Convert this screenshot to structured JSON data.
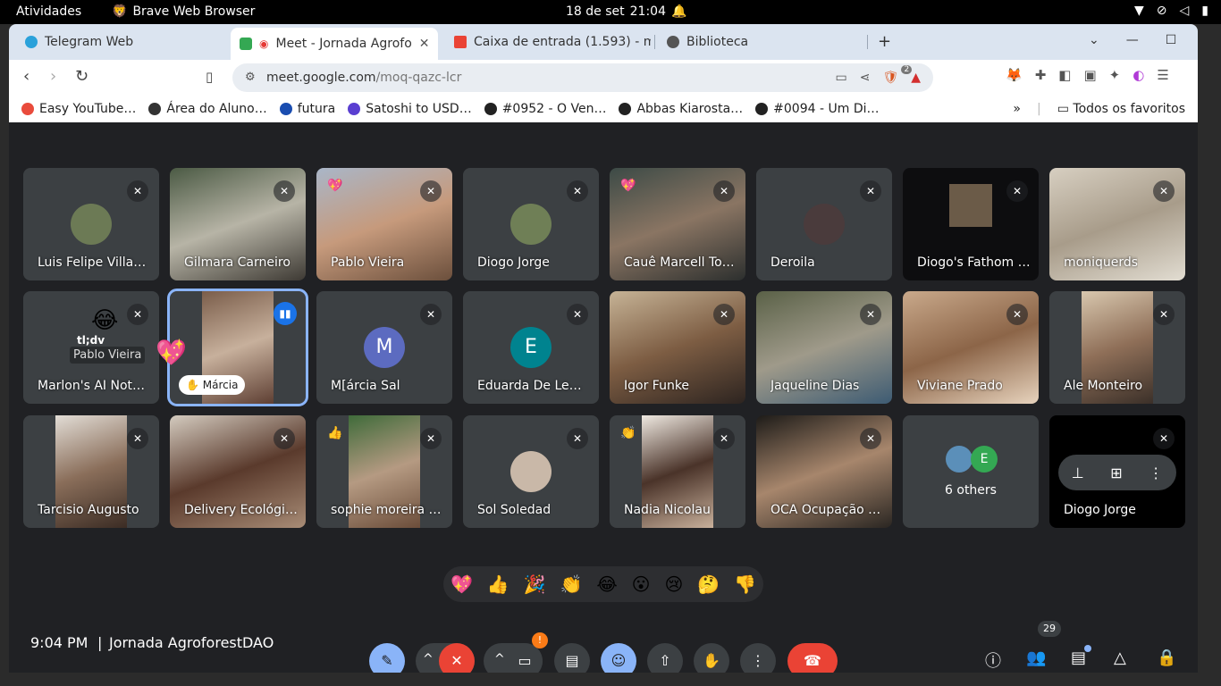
{
  "os_bar": {
    "activities": "Atividades",
    "app_name": "Brave Web Browser",
    "date": "18 de set",
    "time": "21:04"
  },
  "browser": {
    "tabs": [
      {
        "label": "Telegram Web",
        "color": "#2aa1da"
      },
      {
        "label": "Meet - Jornada Agrofo",
        "color": "#34a853"
      },
      {
        "label": "Caixa de entrada (1.593) - m",
        "color": "#ea4335"
      },
      {
        "label": "Biblioteca",
        "color": "#555555"
      }
    ],
    "new_tab": "+",
    "url_domain": "meet.google.com",
    "url_path": "/moq-qazc-lcr",
    "brave_badge": "2",
    "bookmarks": [
      {
        "label": "Easy YouTube…",
        "color": "#e94b3c"
      },
      {
        "label": "Área do Aluno…",
        "color": "#333333"
      },
      {
        "label": "futura",
        "color": "#1a4db0"
      },
      {
        "label": "Satoshi to USD…",
        "color": "#5a3fd1"
      },
      {
        "label": "#0952 - O Ven…",
        "color": "#222222"
      },
      {
        "label": "Abbas Kiarosta…",
        "color": "#222222"
      },
      {
        "label": "#0094 - Um Di…",
        "color": "#222222"
      }
    ],
    "bookmarks_overflow": "»",
    "all_bookmarks": "Todos os favoritos"
  },
  "meet": {
    "participants": [
      {
        "name": "Luis Felipe Villas…",
        "kind": "avatar"
      },
      {
        "name": "Gilmara Carneiro",
        "kind": "video"
      },
      {
        "name": "Pablo Vieira",
        "kind": "video",
        "reaction": "💖"
      },
      {
        "name": "Diogo Jorge",
        "kind": "avatar"
      },
      {
        "name": "Cauê Marcell To…",
        "kind": "video",
        "reaction": "💖"
      },
      {
        "name": "Deroila",
        "kind": "avatar"
      },
      {
        "name": "Diogo's Fathom …",
        "kind": "video"
      },
      {
        "name": "moniquerds",
        "kind": "video"
      },
      {
        "name": "Marlon's AI Note…",
        "kind": "avatar",
        "overlay_label": "Pablo Vieira",
        "overlay_emoji": "😂",
        "logo": "tl;dv"
      },
      {
        "name": "Márcia",
        "kind": "video",
        "speaking": true,
        "float_emoji": "💖"
      },
      {
        "name": "M[árcia Sal",
        "kind": "letter",
        "letter": "M",
        "color": "#5c6bc0"
      },
      {
        "name": "Eduarda De Lem…",
        "kind": "letter",
        "letter": "E",
        "color": "#00838f"
      },
      {
        "name": "Igor Funke",
        "kind": "video"
      },
      {
        "name": "Jaqueline Dias",
        "kind": "video"
      },
      {
        "name": "Viviane Prado",
        "kind": "video"
      },
      {
        "name": "Ale Monteiro",
        "kind": "video"
      },
      {
        "name": "Tarcisio Augusto",
        "kind": "video"
      },
      {
        "name": "Delivery Ecológi…",
        "kind": "video"
      },
      {
        "name": "sophie moreira …",
        "kind": "video",
        "reaction": "👍"
      },
      {
        "name": "Sol Soledad",
        "kind": "avatar"
      },
      {
        "name": "Nadia Nicolau",
        "kind": "video",
        "reaction": "👏"
      },
      {
        "name": "OCA Ocupação …",
        "kind": "video"
      },
      {
        "name": "6 others",
        "kind": "others",
        "letter": "E"
      },
      {
        "name": "Diogo Jorge",
        "kind": "hover"
      }
    ],
    "emoji_reactions": [
      "💖",
      "👍",
      "🎉",
      "👏",
      "😂",
      "😮",
      "😢",
      "🤔",
      "👎"
    ],
    "clock": "9:04 PM",
    "meeting_name": "Jornada AgroforestDAO",
    "people_count": "29",
    "camera_alert": "!"
  }
}
